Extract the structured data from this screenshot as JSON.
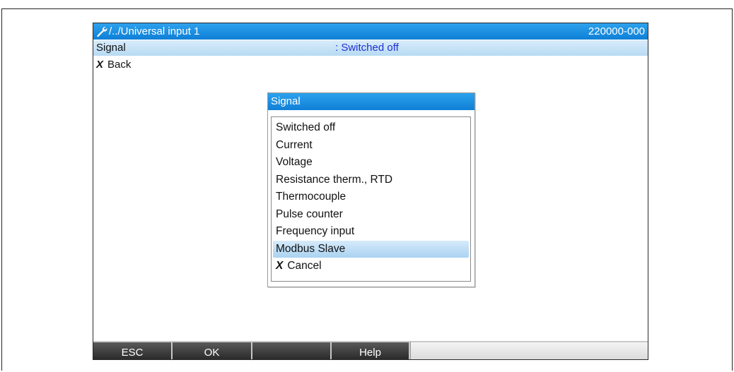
{
  "header": {
    "path": "/../Universal input 1",
    "device_id": "220000-000",
    "icon": "wrench-icon"
  },
  "parameter": {
    "label": "Signal",
    "value": ": Switched off"
  },
  "back": {
    "label": "Back",
    "icon": "x-mark-icon"
  },
  "dialog": {
    "title": "Signal",
    "options": [
      "Switched off",
      "Current",
      "Voltage",
      "Resistance therm., RTD",
      "Thermocouple",
      "Pulse counter",
      "Frequency input",
      "Modbus Slave"
    ],
    "selected_option": "Modbus Slave",
    "cancel_label": "Cancel"
  },
  "softkeys": {
    "esc": "ESC",
    "ok": "OK",
    "blank": "",
    "help": "Help"
  },
  "colors": {
    "title_blue": "#1a8ee3",
    "selection_blue": "#b7daf3",
    "value_text": "#1d2fd6",
    "softkey_dark": "#3a3a3a"
  }
}
